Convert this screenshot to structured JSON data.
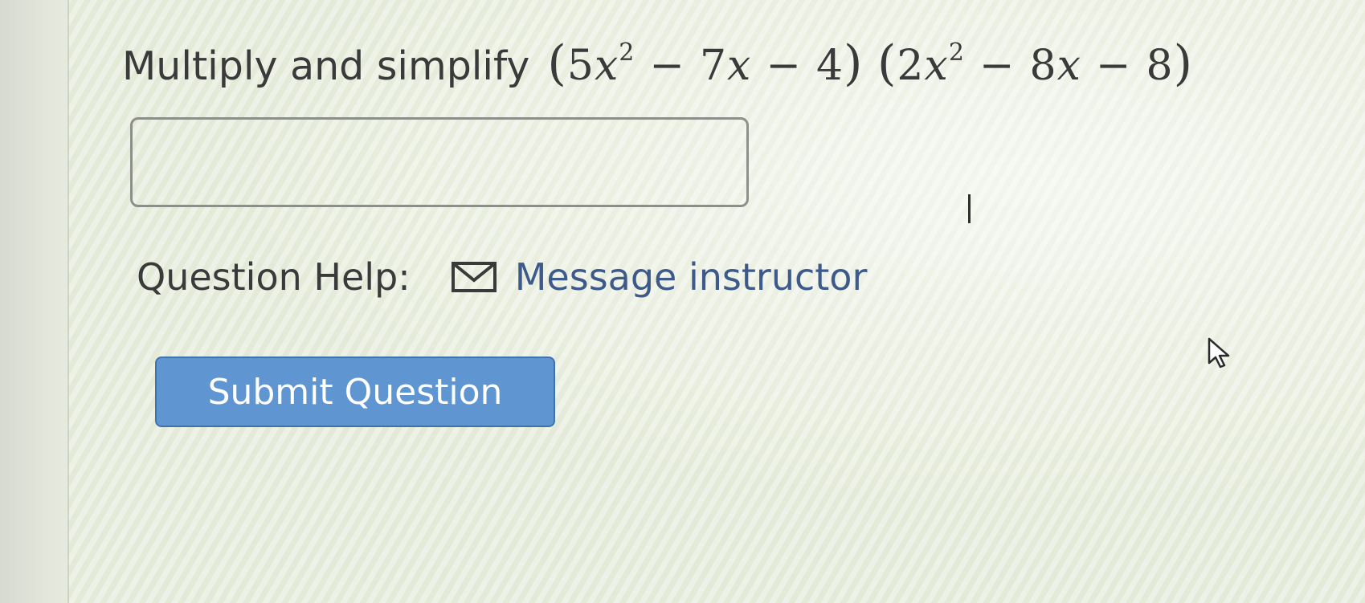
{
  "question": {
    "prompt": "Multiply and simplify",
    "expression": {
      "open1": "(",
      "t1_coef": "5",
      "t1_var": "x",
      "t1_exp": "2",
      "op1": "−",
      "t2_coef": "7",
      "t2_var": "x",
      "op2": "−",
      "t3": "4",
      "close1": ")",
      "open2": "(",
      "u1_coef": "2",
      "u1_var": "x",
      "u1_exp": "2",
      "op3": "−",
      "u2_coef": "8",
      "u2_var": "x",
      "op4": "−",
      "u3": "8",
      "close2": ")"
    }
  },
  "answer": {
    "value": "",
    "placeholder": ""
  },
  "help": {
    "label": "Question Help:",
    "message_link": "Message instructor",
    "icon": "mail-icon"
  },
  "submit": {
    "label": "Submit Question",
    "color": "#5f95d1"
  },
  "pointer": {
    "icon": "mouse-pointer-icon"
  }
}
